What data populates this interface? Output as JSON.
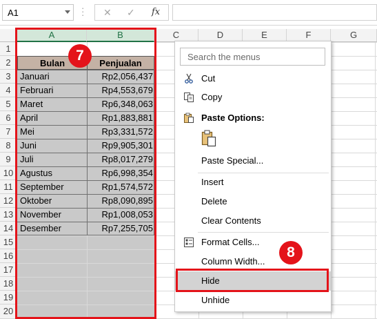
{
  "formula_bar": {
    "name_box": "A1",
    "cancel_icon": "x-icon",
    "enter_icon": "check-icon",
    "fx_label": "fx"
  },
  "columns": [
    "A",
    "B",
    "C",
    "D",
    "E",
    "F",
    "G"
  ],
  "rows": [
    "1",
    "2",
    "3",
    "4",
    "5",
    "6",
    "7",
    "8",
    "9",
    "10",
    "11",
    "12",
    "13",
    "14",
    "15",
    "16",
    "17",
    "18",
    "19",
    "20"
  ],
  "table": {
    "header": {
      "bulan": "Bulan",
      "penjualan": "Penjualan"
    },
    "rows": [
      {
        "bulan": "Januari",
        "penjualan": "Rp2,056,437"
      },
      {
        "bulan": "Februari",
        "penjualan": "Rp4,553,679"
      },
      {
        "bulan": "Maret",
        "penjualan": "Rp6,348,063"
      },
      {
        "bulan": "April",
        "penjualan": "Rp1,883,881"
      },
      {
        "bulan": "Mei",
        "penjualan": "Rp3,331,572"
      },
      {
        "bulan": "Juni",
        "penjualan": "Rp9,905,301"
      },
      {
        "bulan": "Juli",
        "penjualan": "Rp8,017,279"
      },
      {
        "bulan": "Agustus",
        "penjualan": "Rp6,998,354"
      },
      {
        "bulan": "September",
        "penjualan": "Rp1,574,572"
      },
      {
        "bulan": "Oktober",
        "penjualan": "Rp8,090,895"
      },
      {
        "bulan": "November",
        "penjualan": "Rp1,008,053"
      },
      {
        "bulan": "Desember",
        "penjualan": "Rp7,255,705"
      }
    ]
  },
  "badges": {
    "step7": "7",
    "step8": "8"
  },
  "context_menu": {
    "search_placeholder": "Search the menus",
    "cut": "Cut",
    "copy": "Copy",
    "paste_options": "Paste Options:",
    "paste_special": "Paste Special...",
    "insert": "Insert",
    "delete": "Delete",
    "clear_contents": "Clear Contents",
    "format_cells": "Format Cells...",
    "column_width": "Column Width...",
    "hide": "Hide",
    "unhide": "Unhide"
  },
  "colors": {
    "accent_red": "#e4131a",
    "header_fill": "#c4b2a5",
    "selection_gray": "#c9c9c9",
    "excel_green": "#217346"
  }
}
